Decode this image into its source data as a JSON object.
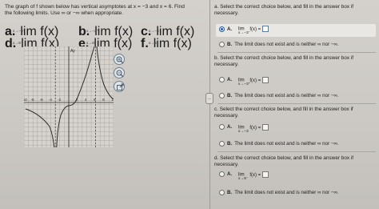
{
  "problem": {
    "text_line1": "The graph of f shown below has vertical asymptotes at x = −3 and x = 6. Find",
    "text_line2": "the following limits. Use ∞ or −∞ when appropriate."
  },
  "limits": [
    {
      "label": "a.",
      "expr": "lim  f(x)",
      "sub": "x→−3⁻"
    },
    {
      "label": "b.",
      "expr": "lim  f(x)",
      "sub": "x→−3⁺"
    },
    {
      "label": "c.",
      "expr": "lim  f(x)",
      "sub": "x→−3"
    },
    {
      "label": "d.",
      "expr": "lim  f(x)",
      "sub": "x→6⁻"
    },
    {
      "label": "e.",
      "expr": "lim  f(x)",
      "sub": "x→6⁺"
    },
    {
      "label": "f.",
      "expr": "lim  f(x)",
      "sub": "x→6"
    }
  ],
  "graph": {
    "y_axis_label": "Ay",
    "x_ticks": [
      "-10",
      "-8",
      "-6",
      "-4",
      "-2",
      "2",
      "4",
      "6",
      "8",
      "10"
    ]
  },
  "sections": [
    {
      "head1": "a. Select the correct choice below, and fill in the answer box if",
      "head2": "necessary.",
      "optA_letter": "A.",
      "optA_lim": "lim",
      "optA_fx": "f(x) =",
      "optA_sub": "x→−3⁻",
      "optB_letter": "B.",
      "optB_text": "The limit does not exist and is neither ∞ nor −∞.",
      "selected": "A"
    },
    {
      "head1": "b. Select the correct choice below, and fill in the answer box if",
      "head2": "necessary.",
      "optA_letter": "A.",
      "optA_lim": "lim",
      "optA_fx": "f(x) =",
      "optA_sub": "x→−3⁺",
      "optB_letter": "B.",
      "optB_text": "The limit does not exist and is neither ∞ nor −∞.",
      "selected": ""
    },
    {
      "head1": "c. Select the correct choice below, and fill in the answer box if",
      "head2": "necessary.",
      "optA_letter": "A.",
      "optA_lim": "lim",
      "optA_fx": "f(x) =",
      "optA_sub": "x→−3",
      "optB_letter": "B.",
      "optB_text": "The limit does not exist and is neither ∞ nor −∞.",
      "selected": ""
    },
    {
      "head1": "d. Select the correct choice below, and fill in the answer box if",
      "head2": "necessary.",
      "optA_letter": "A.",
      "optA_lim": "lim",
      "optA_fx": "f(x) =",
      "optA_sub": "x→6⁻",
      "optB_letter": "B.",
      "optB_text": "The limit does not exist and is neither ∞ nor −∞.",
      "selected": ""
    }
  ],
  "tools": [
    "zoom-in-icon",
    "zoom-out-icon",
    "external-link-icon"
  ],
  "handle_glyph": "‥"
}
